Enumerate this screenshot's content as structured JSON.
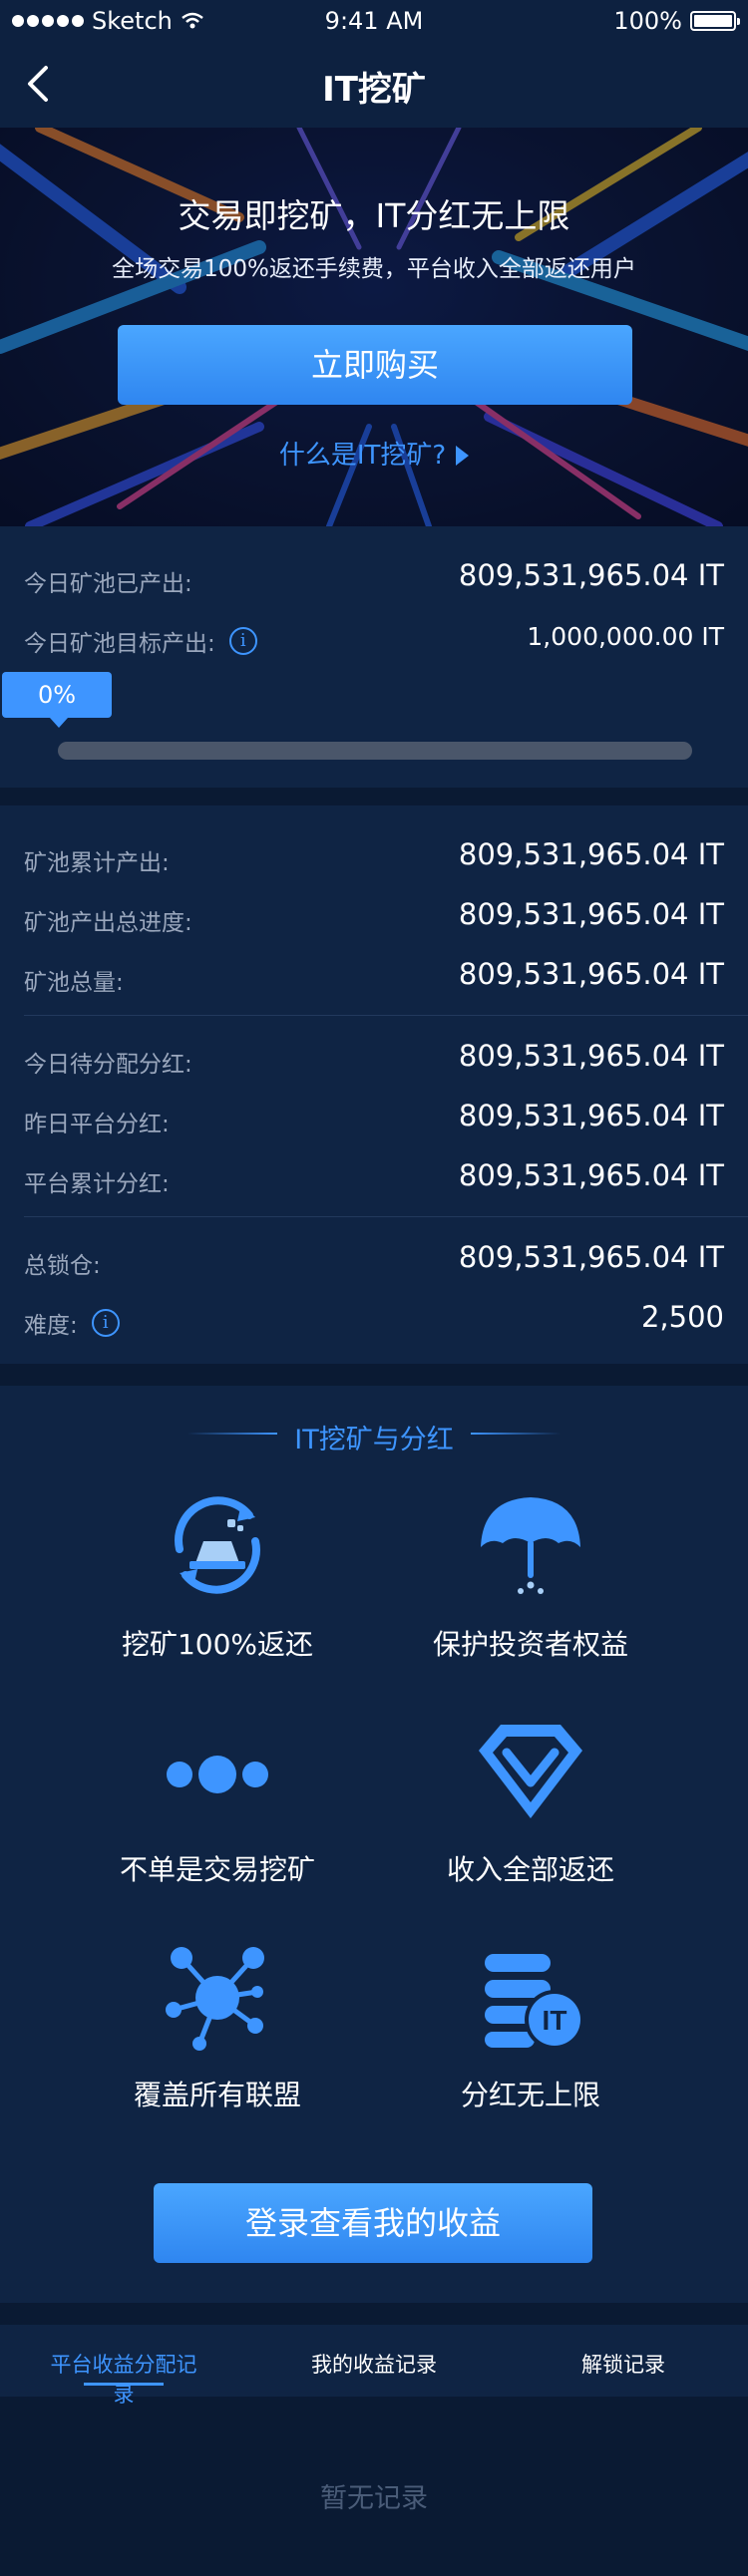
{
  "status_bar": {
    "carrier": "Sketch",
    "time": "9:41 AM",
    "battery": "100%"
  },
  "nav": {
    "title": "IT挖矿"
  },
  "hero": {
    "headline": "交易即挖矿，IT分红无上限",
    "subline": "全场交易100%返还手续费，平台收入全部返还用户",
    "buy_label": "立即购买",
    "whatis_label": "什么是IT挖矿?"
  },
  "today": {
    "produced_label": "今日矿池已产出:",
    "produced_value": "809,531,965.04 IT",
    "target_label": "今日矿池目标产出:",
    "target_value": "1,000,000.00 IT",
    "progress_label": "0%",
    "progress_fraction": 0
  },
  "stats": {
    "total_output_label": "矿池累计产出:",
    "total_output_value": "809,531,965.04 IT",
    "output_progress_label": "矿池产出总进度:",
    "output_progress_value": "809,531,965.04 IT",
    "pool_total_label": "矿池总量:",
    "pool_total_value": "809,531,965.04 IT",
    "pending_dividend_label": "今日待分配分红:",
    "pending_dividend_value": "809,531,965.04 IT",
    "yesterday_dividend_label": "昨日平台分红:",
    "yesterday_dividend_value": "809,531,965.04 IT",
    "cumulative_dividend_label": "平台累计分红:",
    "cumulative_dividend_value": "809,531,965.04 IT",
    "total_locked_label": "总锁仓:",
    "total_locked_value": "809,531,965.04 IT",
    "difficulty_label": "难度:",
    "difficulty_value": "2,500"
  },
  "features": {
    "section_title": "IT挖矿与分红",
    "items": [
      {
        "label": "挖矿100%返还",
        "icon": "refresh-gold-icon"
      },
      {
        "label": "保护投资者权益",
        "icon": "umbrella-icon"
      },
      {
        "label": "不单是交易挖矿",
        "icon": "three-dots-icon"
      },
      {
        "label": "收入全部返还",
        "icon": "diamond-icon"
      },
      {
        "label": "覆盖所有联盟",
        "icon": "network-icon"
      },
      {
        "label": "分红无上限",
        "icon": "coin-stack-icon"
      }
    ],
    "login_label": "登录查看我的收益"
  },
  "tabs": {
    "items": [
      "平台收益分配记录",
      "我的收益记录",
      "解锁记录"
    ],
    "empty_text": "暂无记录"
  },
  "colors": {
    "accent": "#3e95ff",
    "background": "#0a1a33",
    "card": "#0f2444"
  }
}
